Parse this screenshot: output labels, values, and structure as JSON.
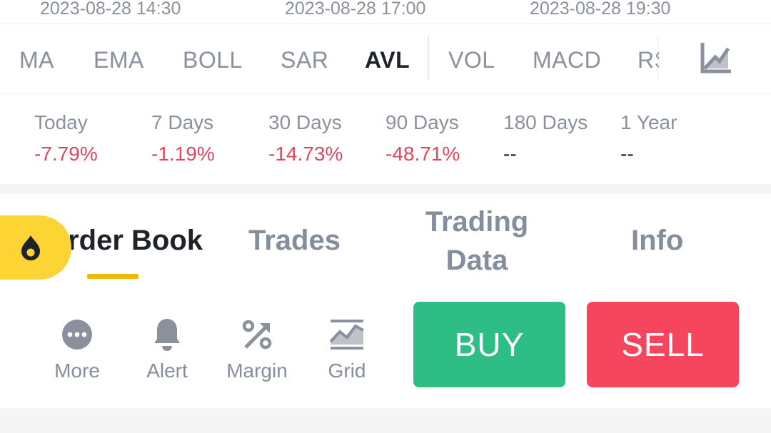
{
  "time_axis": {
    "labels": [
      "2023-08-28 14:30",
      "2023-08-28 17:00",
      "2023-08-28 19:30"
    ]
  },
  "indicators": {
    "items": [
      "MA",
      "EMA",
      "BOLL",
      "SAR",
      "AVL",
      "VOL",
      "MACD",
      "RSI"
    ],
    "active": "AVL",
    "chart_settings_icon": "chart-settings-icon"
  },
  "performance": {
    "items": [
      {
        "label": "Today",
        "value": "-7.79%"
      },
      {
        "label": "7 Days",
        "value": "-1.19%"
      },
      {
        "label": "30 Days",
        "value": "-14.73%"
      },
      {
        "label": "90 Days",
        "value": "-48.71%"
      },
      {
        "label": "180 Days",
        "value": "--"
      },
      {
        "label": "1 Year",
        "value": "--"
      }
    ],
    "negative_color": "#e0475f"
  },
  "tabs": {
    "items": [
      "Order Book",
      "Trades",
      "Trading",
      "Data",
      "Info"
    ],
    "active": "Order Book",
    "accent": "#f0b90b",
    "fab_icon": "flame-icon"
  },
  "actions": {
    "items": [
      {
        "label": "More",
        "icon": "more-icon"
      },
      {
        "label": "Alert",
        "icon": "bell-icon"
      },
      {
        "label": "Margin",
        "icon": "percent-icon"
      },
      {
        "label": "Grid",
        "icon": "grid-chart-icon"
      }
    ],
    "buy_label": "BUY",
    "sell_label": "SELL",
    "buy_color": "#2ebd85",
    "sell_color": "#f6465d"
  }
}
